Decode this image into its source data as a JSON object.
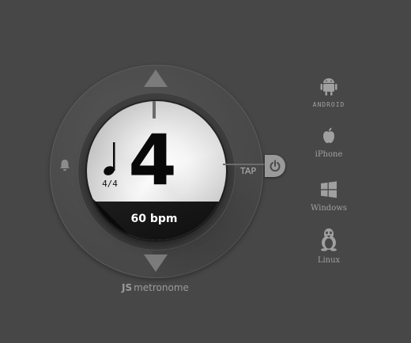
{
  "metronome": {
    "beat_number": "4",
    "time_signature": "4/4",
    "bpm_text": "60 bpm",
    "tap_label": "TAP",
    "brand_js": "JS",
    "brand_name": "metronome"
  },
  "platforms": [
    {
      "label": "ANDROID",
      "icon": "android-icon"
    },
    {
      "label": "iPhone",
      "icon": "apple-icon"
    },
    {
      "label": "Windows",
      "icon": "windows-icon"
    },
    {
      "label": "Linux",
      "icon": "tux-icon"
    }
  ],
  "colors": {
    "background": "#474747",
    "dial_face": "#f0f0f0",
    "dial_dark": "#151515",
    "icon_gray": "#a0a0a0"
  }
}
